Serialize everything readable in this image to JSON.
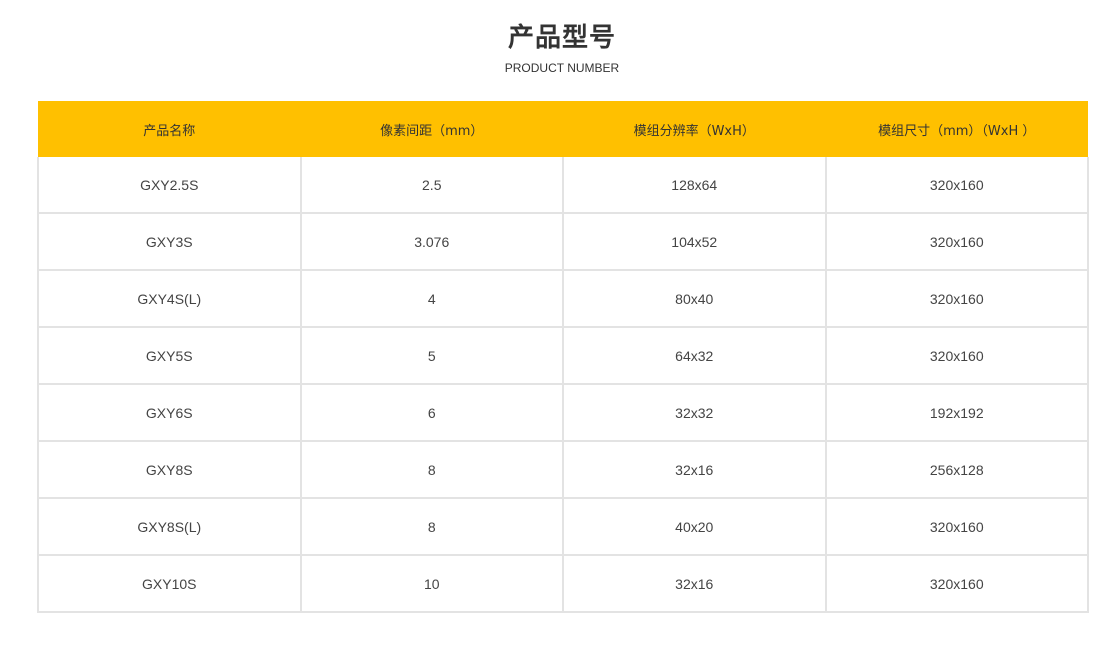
{
  "header": {
    "title": "产品型号",
    "subtitle": "PRODUCT NUMBER"
  },
  "table": {
    "columns": [
      "产品名称",
      "像素间距（mm）",
      "模组分辨率（WxH）",
      "模组尺寸（mm）（WxH ）"
    ],
    "rows": [
      [
        "GXY2.5S",
        "2.5",
        "128x64",
        "320x160"
      ],
      [
        "GXY3S",
        "3.076",
        "104x52",
        "320x160"
      ],
      [
        "GXY4S(L)",
        "4",
        "80x40",
        "320x160"
      ],
      [
        "GXY5S",
        "5",
        "64x32",
        "320x160"
      ],
      [
        "GXY6S",
        "6",
        "32x32",
        "192x192"
      ],
      [
        "GXY8S",
        "8",
        "32x16",
        "256x128"
      ],
      [
        "GXY8S(L)",
        "8",
        "40x20",
        "320x160"
      ],
      [
        "GXY10S",
        "10",
        "32x16",
        "320x160"
      ]
    ]
  },
  "colors": {
    "header_bg": "#ffc000",
    "grid_line": "#e3e3e3",
    "text": "#333333"
  }
}
